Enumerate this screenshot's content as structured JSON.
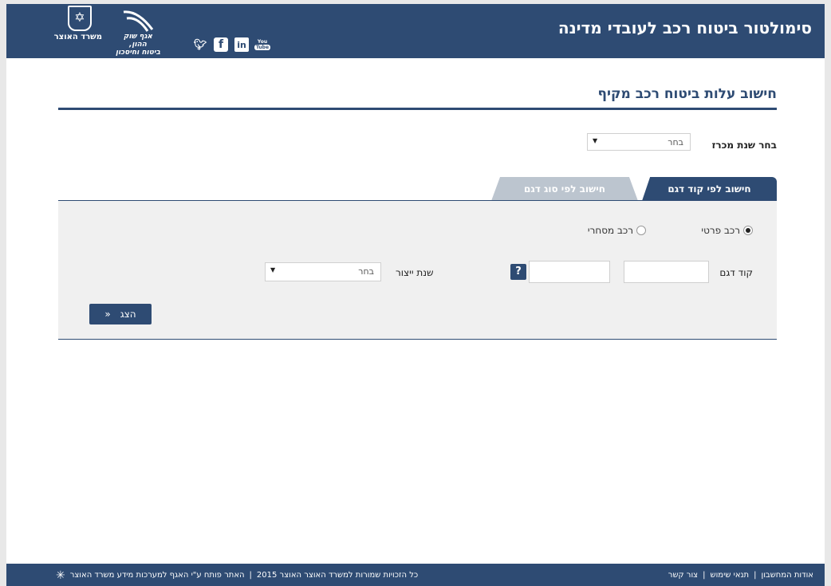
{
  "header": {
    "title": "סימולטור ביטוח רכב לעובדי מדינה",
    "logo_ministry": "משרד האוצר",
    "logo_agaf_line1": "אגף שוק ההון,",
    "logo_agaf_line2": "ביטוח וחיסכון",
    "socials": [
      "twitter-icon",
      "facebook-icon",
      "linkedin-icon",
      "youtube-icon"
    ],
    "youtube_top": "You",
    "youtube_bottom": "Tube"
  },
  "page": {
    "heading": "חישוב עלות ביטוח רכב מקיף",
    "year_label": "בחר שנת מכרז",
    "year_select_value": "בחר"
  },
  "tabs": [
    {
      "label": "חישוב לפי קוד דגם",
      "active": true
    },
    {
      "label": "חישוב לפי סוג דגם",
      "active": false
    }
  ],
  "form": {
    "radio_private": "רכב פרטי",
    "radio_commercial": "רכב מסחרי",
    "code_label": "קוד דגם",
    "help_label": "?",
    "prod_year_label": "שנת ייצור",
    "prod_year_value": "בחר",
    "show_button": "הצג",
    "show_button_icon": "«"
  },
  "footer": {
    "about": "אודות המחשבון",
    "terms": "תנאי שימוש",
    "contact": "צור קשר",
    "developed_by": "האתר פותח ע\"י האגף למערכות מידע משרד האוצר",
    "copyright": "כל הזכויות שמורות למשרד האוצר האוצר 2015"
  },
  "colors": {
    "brand": "#2e4b73",
    "tab_inactive": "#bcc5cf",
    "panel": "#f0f0f0"
  }
}
